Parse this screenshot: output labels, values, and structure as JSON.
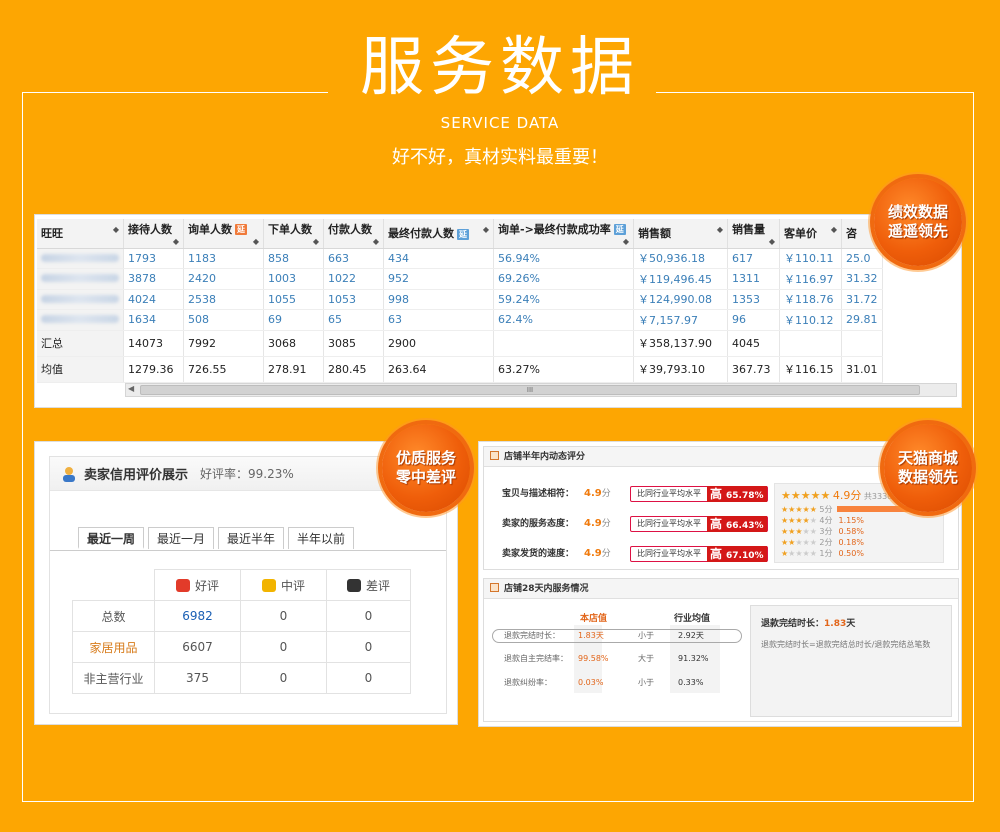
{
  "header": {
    "title": "服务数据",
    "subtitle_en": "SERVICE DATA",
    "subtitle_cn": "好不好，真材实料最重要！"
  },
  "seals": {
    "performance": [
      "绩效数据",
      "遥遥领先"
    ],
    "service": [
      "优质服务",
      "零中差评"
    ],
    "tmall": [
      "天猫商城",
      "数据领先"
    ]
  },
  "service_table": {
    "columns": [
      {
        "label": "旺旺",
        "tag": ""
      },
      {
        "label": "接待人数",
        "tag": ""
      },
      {
        "label": "询单人数",
        "tag": "延"
      },
      {
        "label": "下单人数",
        "tag": ""
      },
      {
        "label": "付款人数",
        "tag": ""
      },
      {
        "label": "最终付款人数",
        "tag": "延"
      },
      {
        "label": "询单->最终付款成功率",
        "tag": "延"
      },
      {
        "label": "销售额",
        "tag": ""
      },
      {
        "label": "销售量",
        "tag": ""
      },
      {
        "label": "客单价",
        "tag": ""
      },
      {
        "label": "咨",
        "tag": ""
      }
    ],
    "rows": [
      [
        "",
        "1793",
        "1183",
        "858",
        "663",
        "434",
        "56.94%",
        "￥50,936.18",
        "617",
        "￥110.11",
        "25.0"
      ],
      [
        "",
        "3878",
        "2420",
        "1003",
        "1022",
        "952",
        "69.26%",
        "￥119,496.45",
        "1311",
        "￥116.97",
        "31.32"
      ],
      [
        "",
        "4024",
        "2538",
        "1055",
        "1053",
        "998",
        "59.24%",
        "￥124,990.08",
        "1353",
        "￥118.76",
        "31.72"
      ],
      [
        "",
        "1634",
        "508",
        "69",
        "65",
        "63",
        "62.4%",
        "￥7,157.97",
        "96",
        "￥110.12",
        "29.81"
      ],
      [
        "汇总",
        "14073",
        "7992",
        "3068",
        "3085",
        "2900",
        "",
        "￥358,137.90",
        "4045",
        "",
        ""
      ],
      [
        "均值",
        "1279.36",
        "726.55",
        "278.91",
        "280.45",
        "263.64",
        "63.27%",
        "￥39,793.10",
        "367.73",
        "￥116.15",
        "31.01"
      ]
    ],
    "scroll_grip": "III"
  },
  "credit": {
    "title": "卖家信用评价展示",
    "rate": "好评率：99.23%",
    "tabs": [
      "最近一周",
      "最近一月",
      "最近半年",
      "半年以前"
    ],
    "active_tab": 0,
    "col_headers": [
      "好评",
      "中评",
      "差评"
    ],
    "rows": [
      {
        "label": "总数",
        "good": "6982",
        "mid": "0",
        "bad": "0"
      },
      {
        "label": "家居用品",
        "good": "6607",
        "mid": "0",
        "bad": "0"
      },
      {
        "label": "非主营行业",
        "good": "375",
        "mid": "0",
        "bad": "0"
      }
    ],
    "colors": {
      "good_total": "#1a5fb4",
      "category": "#d77b1a"
    }
  },
  "store_rating": {
    "title": "店铺半年内动态评分",
    "items": [
      {
        "label": "宝贝与描述相符：",
        "score": "4.9",
        "unit": "分",
        "compare": "比同行业平均水平",
        "level": "高",
        "pct": "65.78%"
      },
      {
        "label": "卖家的服务态度：",
        "score": "4.9",
        "unit": "分",
        "compare": "比同行业平均水平",
        "level": "高",
        "pct": "66.43%"
      },
      {
        "label": "卖家发货的速度：",
        "score": "4.9",
        "unit": "分",
        "compare": "比同行业平均水平",
        "level": "高",
        "pct": "67.10%"
      }
    ],
    "stars": {
      "score": "4.9",
      "unit": "分",
      "count_text": "共3338",
      "lines": [
        {
          "label": "5分",
          "pct": ""
        },
        {
          "label": "4分",
          "pct": "1.15%"
        },
        {
          "label": "3分",
          "pct": "0.58%"
        },
        {
          "label": "2分",
          "pct": "0.18%"
        },
        {
          "label": "1分",
          "pct": "0.50%"
        }
      ]
    }
  },
  "service_28": {
    "title": "店铺28天内服务情况",
    "col_store": "本店值",
    "col_industry": "行业均值",
    "rows": [
      {
        "label": "退款完结时长：",
        "store": "1.83天",
        "cmp": "小于",
        "industry": "2.92天"
      },
      {
        "label": "退款自主完结率：",
        "store": "99.58%",
        "cmp": "大于",
        "industry": "91.32%"
      },
      {
        "label": "退款纠纷率：",
        "store": "0.03%",
        "cmp": "小于",
        "industry": "0.33%"
      }
    ],
    "box_title": "退款完结时长：",
    "box_value": "1.83",
    "box_unit": "天",
    "box_note": "退款完结时长=退款完结总时长/退款完结总笔数"
  }
}
